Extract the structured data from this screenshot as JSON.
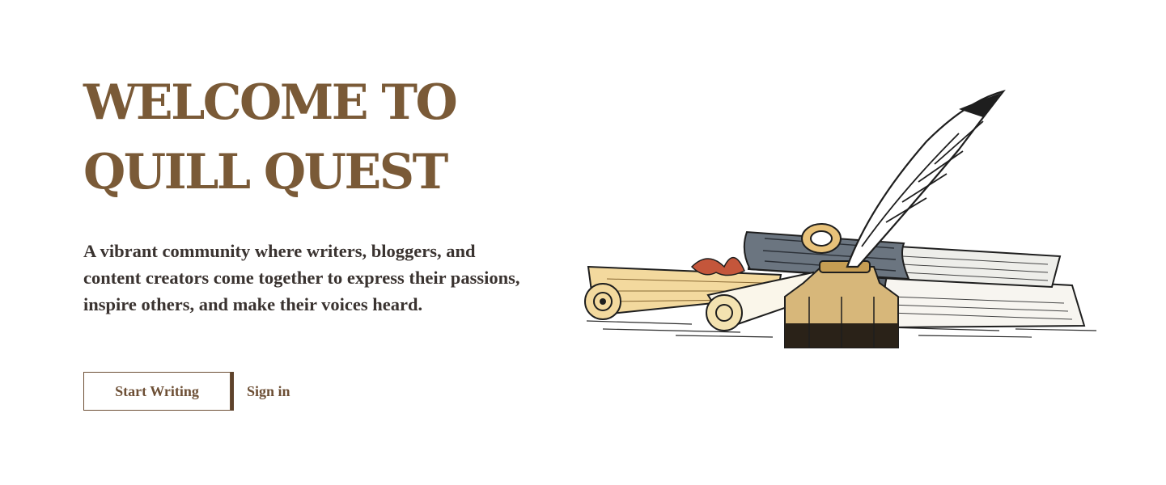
{
  "hero": {
    "title_line1": "WELCOME TO",
    "title_line2": "QUILL QUEST",
    "description": "A vibrant community where writers, bloggers, and content creators come together to express their passions, inspire others, and make their voices heard."
  },
  "actions": {
    "start_writing_label": "Start Writing",
    "sign_in_label": "Sign in"
  },
  "colors": {
    "brand_brown": "#7a5a37",
    "body_text": "#3a3330",
    "button_border": "#6d4f35"
  },
  "illustration": {
    "icon": "quill-inkwell-books-scrolls-illustration"
  }
}
